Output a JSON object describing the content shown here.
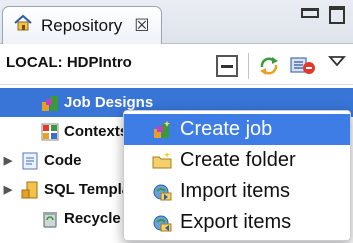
{
  "panel": {
    "tab_title": "Repository",
    "tab_close": "☒",
    "connection_label": "LOCAL: HDPIntro"
  },
  "tree": {
    "items": [
      {
        "label": "Job Designs",
        "icon": "job-designs-icon",
        "expand": ""
      },
      {
        "label": "Contexts",
        "icon": "contexts-icon",
        "expand": ""
      },
      {
        "label": "Code",
        "icon": "code-icon",
        "expand": "▶"
      },
      {
        "label": "SQL Templates",
        "icon": "sql-templates-icon",
        "expand": "▶"
      },
      {
        "label": "Recycle bin",
        "icon": "recycle-bin-icon",
        "expand": ""
      }
    ]
  },
  "context_menu": {
    "items": [
      {
        "label": "Create job",
        "icon": "create-job-icon"
      },
      {
        "label": "Create folder",
        "icon": "create-folder-icon"
      },
      {
        "label": "Import items",
        "icon": "import-items-icon"
      },
      {
        "label": "Export items",
        "icon": "export-items-icon"
      }
    ]
  },
  "colors": {
    "selection": "#3875d7",
    "menu_hover": "#3d7de5"
  }
}
